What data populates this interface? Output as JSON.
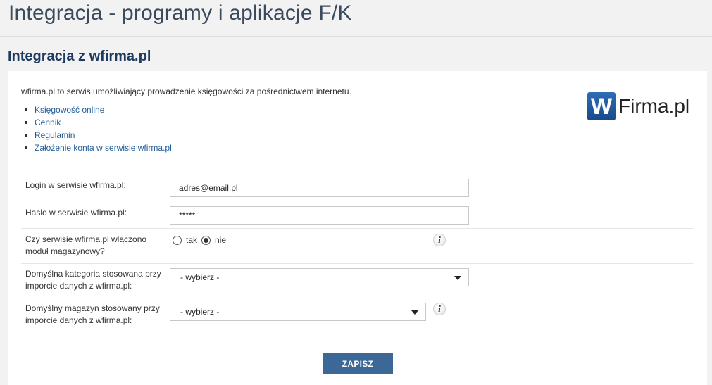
{
  "header": {
    "title": "Integracja - programy i aplikacje F/K"
  },
  "section": {
    "title": "Integracja z wfirma.pl"
  },
  "intro": {
    "text": "wfirma.pl to serwis umożliwiający prowadzenie księgowości za pośrednictwem internetu.",
    "links": [
      {
        "label": "Księgowość online"
      },
      {
        "label": "Cennik"
      },
      {
        "label": "Regulamin"
      },
      {
        "label": "Założenie konta w serwisie wfirma.pl"
      }
    ]
  },
  "logo": {
    "mark": "W",
    "text": "Firma.pl"
  },
  "form": {
    "login": {
      "label": "Login w serwisie wfirma.pl:",
      "value": "adres@email.pl"
    },
    "password": {
      "label": "Hasło w serwisie wfirma.pl:",
      "value": "*****"
    },
    "warehouse_module": {
      "label_line1": "Czy serwisie wfirma.pl włączono",
      "label_line2": "moduł magazynowy?",
      "options": [
        {
          "label": "tak",
          "checked": false
        },
        {
          "label": "nie",
          "checked": true
        }
      ]
    },
    "default_category": {
      "label_line1": "Domyślna kategoria stosowana przy",
      "label_line2": "imporcie danych z wfirma.pl:",
      "selected": "- wybierz -"
    },
    "default_warehouse": {
      "label_line1": "Domyślny magazyn stosowany przy",
      "label_line2": "imporcie danych z wfirma.pl:",
      "selected": "- wybierz -"
    },
    "info_icon_glyph": "i",
    "save_label": "ZAPISZ"
  },
  "colors": {
    "accent": "#3b6896",
    "link": "#1f5c99",
    "title": "#1e3a5f"
  }
}
